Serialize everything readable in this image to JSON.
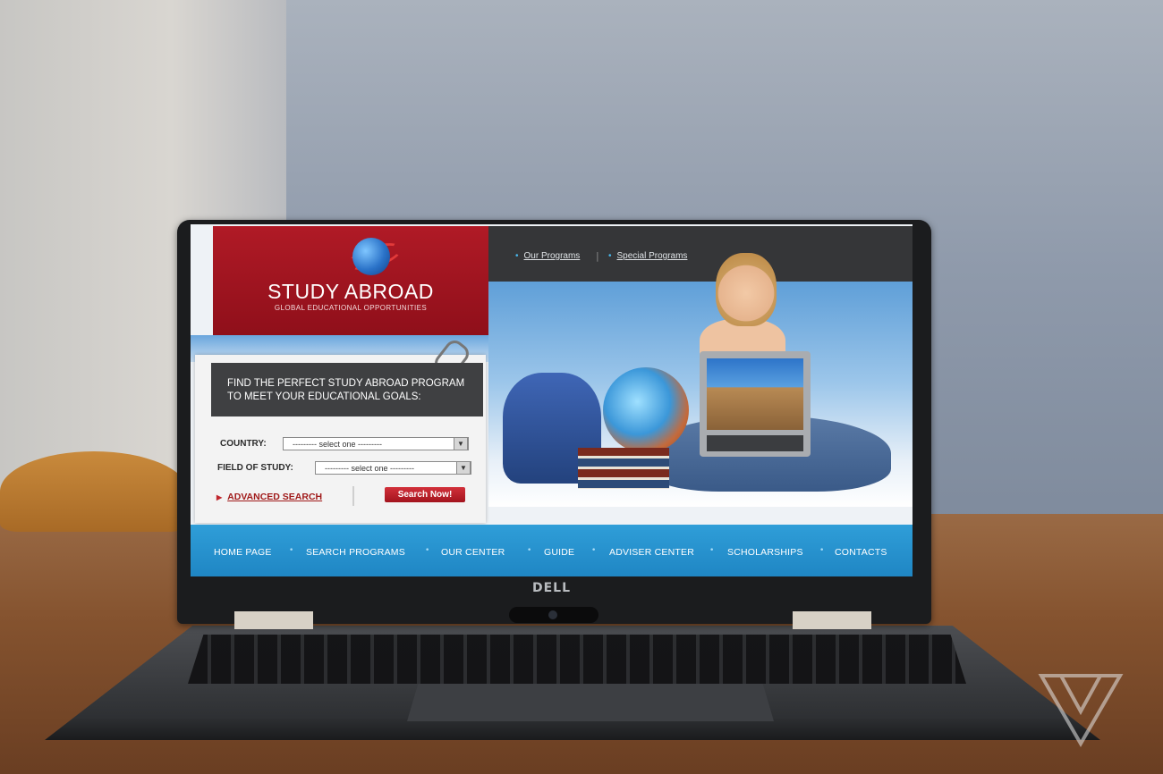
{
  "site": {
    "title": "STUDY ABROAD",
    "subtitle": "GLOBAL EDUCATIONAL OPPORTUNITIES"
  },
  "top_links": [
    {
      "label": "Our Programs"
    },
    {
      "label": "Special Programs"
    }
  ],
  "search_panel": {
    "heading_line1": "FIND THE PERFECT STUDY ABROAD PROGRAM",
    "heading_line2": "TO MEET YOUR EDUCATIONAL GOALS:",
    "country_label": "COUNTRY:",
    "country_value": "---------  select one  ---------",
    "field_label": "FIELD OF STUDY:",
    "field_value": "---------  select one  ---------",
    "advanced_search": "ADVANCED SEARCH",
    "search_button": "Search Now!"
  },
  "nav": [
    {
      "label": "HOME PAGE"
    },
    {
      "label": "SEARCH PROGRAMS"
    },
    {
      "label": "OUR  CENTER"
    },
    {
      "label": "GUIDE"
    },
    {
      "label": "ADVISER CENTER"
    },
    {
      "label": "SCHOLARSHIPS"
    },
    {
      "label": "CONTACTS"
    }
  ],
  "device_brand": "DELL",
  "colors": {
    "brand_red": "#a3141e",
    "nav_blue": "#2f9ed8",
    "topbar_dark": "#353638"
  },
  "icons": [
    "globe-logo-icon",
    "paperclip-icon",
    "dropdown-arrow-icon",
    "advanced-search-arrow-icon",
    "watermark-logo-icon"
  ]
}
